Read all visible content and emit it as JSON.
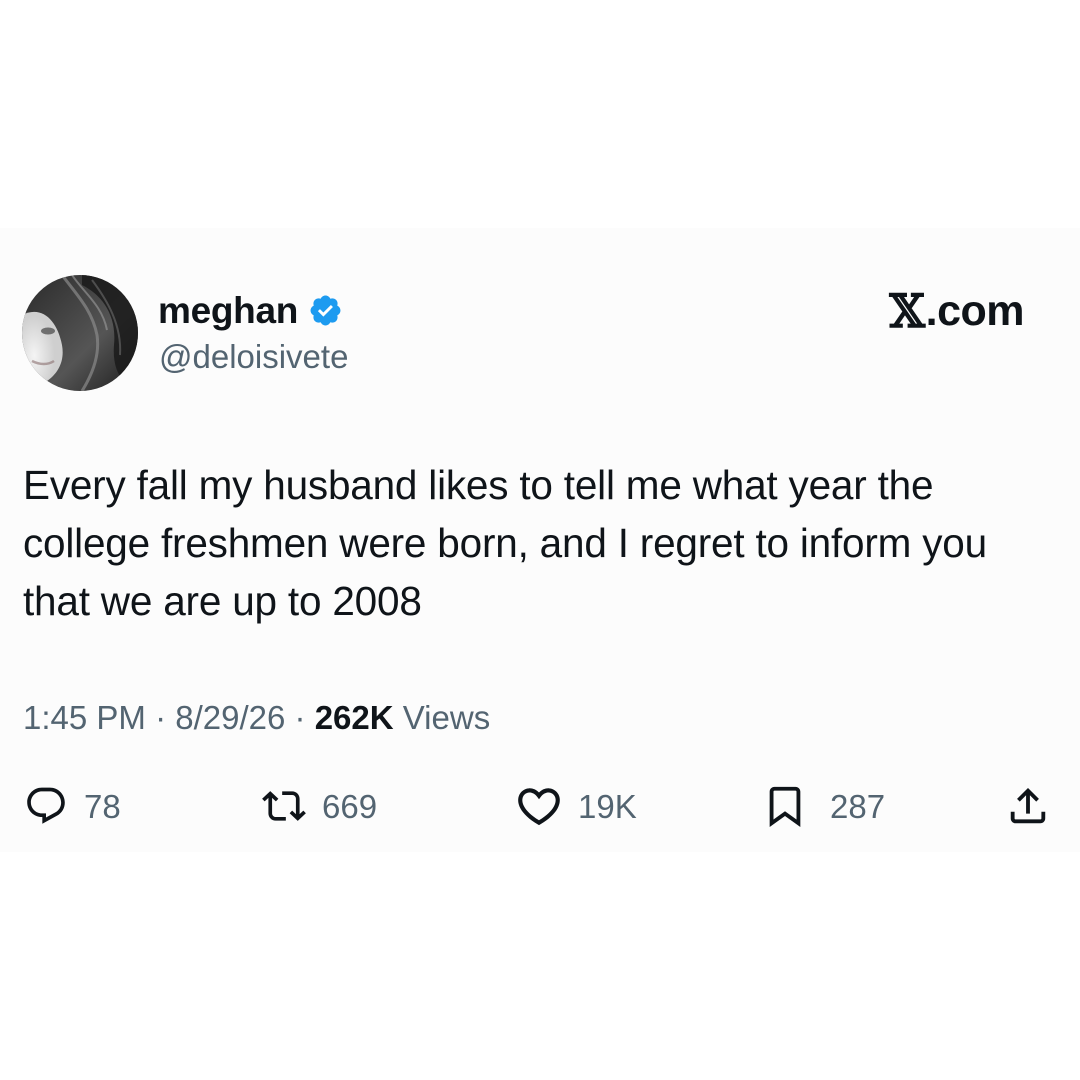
{
  "author": {
    "display_name": "meghan",
    "handle": "@deloisivete",
    "verified": true,
    "verified_color": "#1d9bf0"
  },
  "brand": {
    "x_glyph": "𝕏",
    "domain": ".com"
  },
  "tweet": {
    "text": "Every fall my husband likes to tell me what year the college freshmen were born, and I regret to inform you that we are up to 2008"
  },
  "meta": {
    "time": "1:45 PM",
    "separator": "·",
    "date": "8/29/26",
    "views_count": "262K",
    "views_label": "Views"
  },
  "actions": {
    "reply": {
      "icon": "reply-icon",
      "count": "78"
    },
    "retweet": {
      "icon": "retweet-icon",
      "count": "669"
    },
    "like": {
      "icon": "heart-icon",
      "count": "19K"
    },
    "bookmark": {
      "icon": "bookmark-icon",
      "count": "287"
    },
    "share": {
      "icon": "share-icon"
    }
  },
  "colors": {
    "text_primary": "#0f1419",
    "text_secondary": "#536471",
    "card_background": "#fcfcfc",
    "page_background": "#ffffff"
  }
}
